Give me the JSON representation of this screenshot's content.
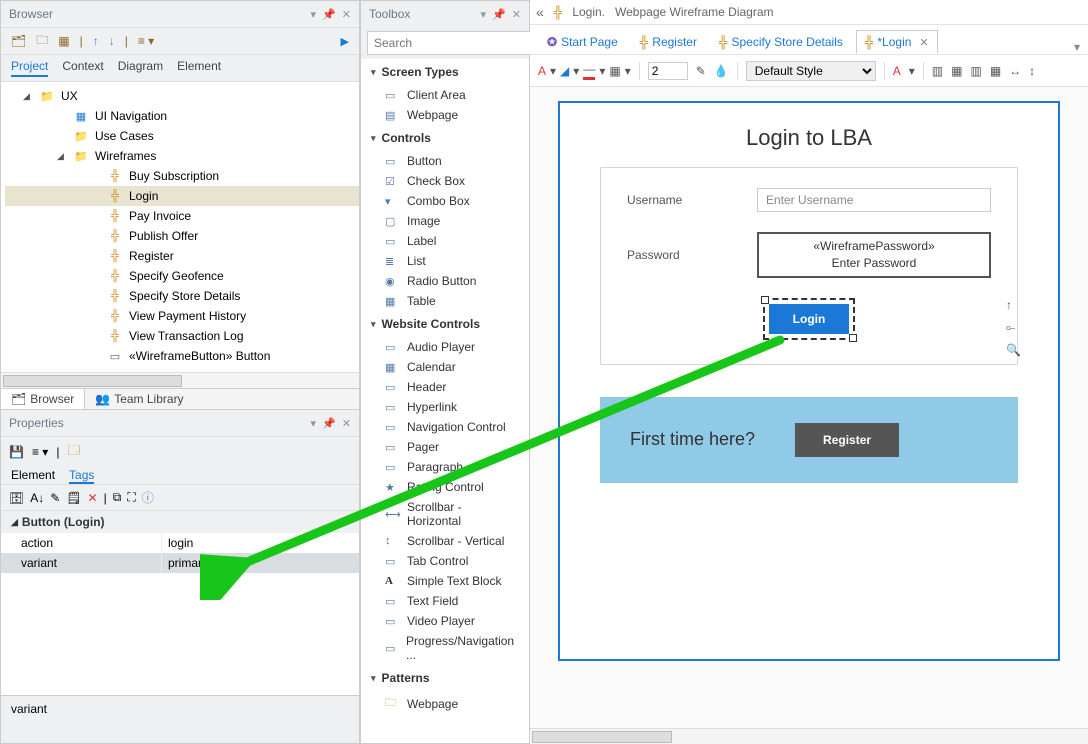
{
  "browser": {
    "title": "Browser",
    "contextTabs": [
      "Project",
      "Context",
      "Diagram",
      "Element"
    ],
    "tree": {
      "root": "UX",
      "nodes": {
        "uiNav": "UI Navigation",
        "useCases": "Use Cases",
        "wireframes": "Wireframes",
        "items": [
          "Buy Subscription",
          "Login",
          "Pay Invoice",
          "Publish Offer",
          "Register",
          "Specify Geofence",
          "Specify Store Details",
          "View Payment History",
          "View Transaction Log",
          "«WireframeButton» Button"
        ]
      }
    },
    "footerTabs": {
      "browser": "Browser",
      "team": "Team Library"
    }
  },
  "properties": {
    "title": "Properties",
    "tabs": [
      "Element",
      "Tags"
    ],
    "section": "Button (Login)",
    "rows": [
      {
        "k": "action",
        "v": "login"
      },
      {
        "k": "variant",
        "v": "primary"
      }
    ],
    "status": "variant"
  },
  "toolbox": {
    "title": "Toolbox",
    "searchPlaceholder": "Search",
    "groups": [
      {
        "name": "Screen Types",
        "items": [
          "Client Area",
          "Webpage"
        ]
      },
      {
        "name": "Controls",
        "items": [
          "Button",
          "Check Box",
          "Combo Box",
          "Image",
          "Label",
          "List",
          "Radio Button",
          "Table"
        ]
      },
      {
        "name": "Website Controls",
        "items": [
          "Audio Player",
          "Calendar",
          "Header",
          "Hyperlink",
          "Navigation Control",
          "Pager",
          "Paragraph",
          "Rating Control",
          "Scrollbar - Horizontal",
          "Scrollbar - Vertical",
          "Tab Control",
          "Simple Text Block",
          "Text Field",
          "Video Player",
          "Progress/Navigation ..."
        ]
      },
      {
        "name": "Patterns",
        "items": [
          "Webpage"
        ]
      }
    ]
  },
  "design": {
    "crumb": {
      "doc": "Login.",
      "sub": "Webpage Wireframe Diagram"
    },
    "tabs": [
      {
        "label": "Start Page",
        "kind": "sp"
      },
      {
        "label": "Register",
        "kind": "wire"
      },
      {
        "label": "Specify Store Details",
        "kind": "wire"
      },
      {
        "label": "*Login",
        "kind": "wire",
        "active": true
      }
    ],
    "toolbar": {
      "lineWeight": "2",
      "style": "Default Style"
    },
    "page": {
      "title": "Login to LBA",
      "usernameLabel": "Username",
      "usernamePlaceholder": "Enter Username",
      "passwordLabel": "Password",
      "passwordStereotype": "«WireframePassword»",
      "passwordPlaceholder": "Enter Password",
      "loginBtn": "Login",
      "ftPrompt": "First time here?",
      "registerBtn": "Register"
    }
  }
}
